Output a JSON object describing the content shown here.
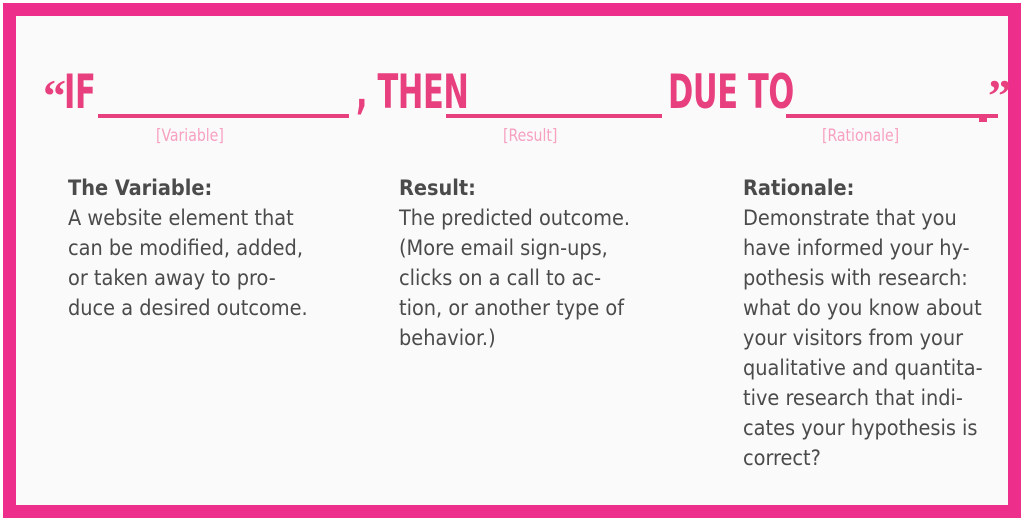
{
  "colors": {
    "accent_pink": "#ED2E8A",
    "headline_pink": "#E8407E",
    "label_pink": "#F7A0C0",
    "body_gray": "#4B4B4B",
    "card_background": "#FAFAFA",
    "page_background": "#FFFFFF"
  },
  "headline": {
    "open_quote": "“",
    "word_if": "IF",
    "comma_then": ", THEN",
    "words_due_to": "DUE TO",
    "period": ".",
    "close_quote": "”",
    "blanks": [
      {
        "label": "[Variable]"
      },
      {
        "label": "[Result]"
      },
      {
        "label": "[Rationale]"
      }
    ]
  },
  "columns": [
    {
      "heading": "The Variable:",
      "lines": [
        "A website element that",
        "can be modified, added,",
        "or taken away to pro-",
        "duce a desired outcome."
      ],
      "text": "A website element that can be modified, added, or taken away to produce a desired outcome."
    },
    {
      "heading": "Result:",
      "lines": [
        "The predicted outcome.",
        "(More email sign-ups,",
        "clicks on a call to ac-",
        "tion, or another type of",
        "behavior.)"
      ],
      "text": "The predicted outcome. (More email sign-ups, clicks on a call to action, or another type of behavior.)"
    },
    {
      "heading": "Rationale:",
      "lines": [
        "Demonstrate that you",
        "have informed your hy-",
        "pothesis with research:",
        "what do you know about",
        "your visitors from your",
        "qualitative and quantita-",
        "tive research that indi-",
        "cates your hypothesis is",
        "correct?"
      ],
      "text": "Demonstrate that you have informed your hypothesis with research: what do you know about your visitors from your qualitative and quantitative research that indicates your hypothesis is correct?"
    }
  ]
}
